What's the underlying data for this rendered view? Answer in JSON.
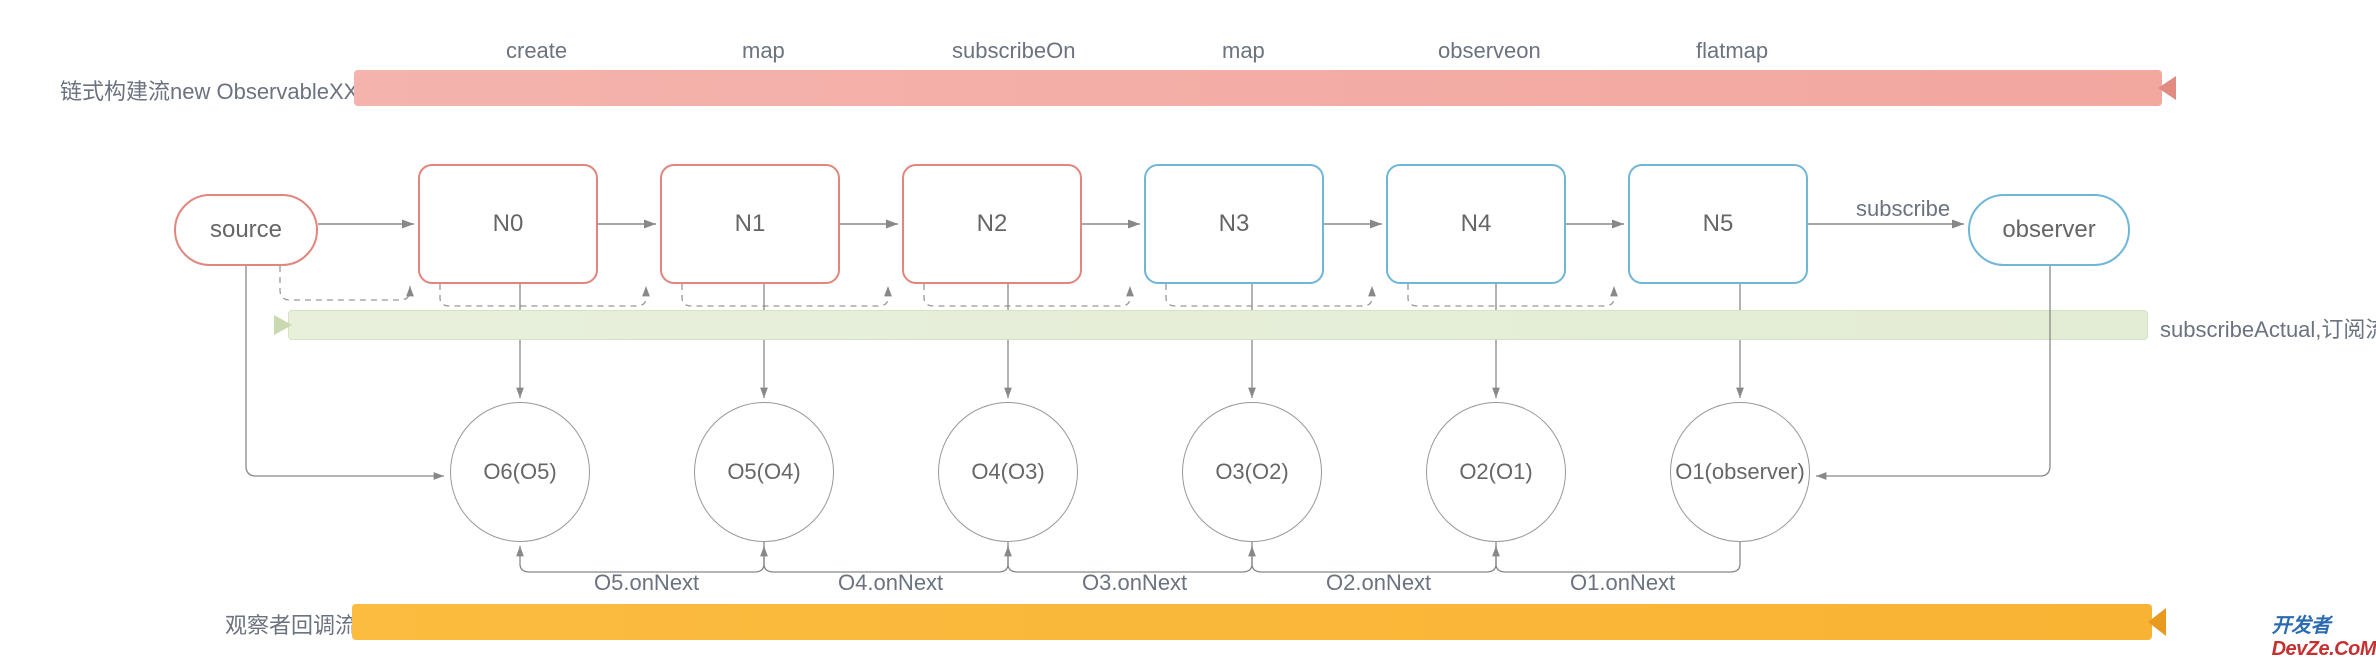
{
  "topBar": {
    "leftLabel": "链式构建流new ObservableXXX",
    "operators": [
      "create",
      "map",
      "subscribeOn",
      "map",
      "observeon",
      "flatmap"
    ]
  },
  "nodes": {
    "source": "source",
    "n": [
      "N0",
      "N1",
      "N2",
      "N3",
      "N4",
      "N5"
    ],
    "subscribeLabel": "subscribe",
    "observer": "observer"
  },
  "midBar": {
    "rightLabel": "subscribeActual,订阅流"
  },
  "observers": {
    "o": [
      "O6(O5)",
      "O5(O4)",
      "O4(O3)",
      "O3(O2)",
      "O2(O1)",
      "O1(observer)"
    ],
    "onNext": [
      "O5.onNext",
      "O4.onNext",
      "O3.onNext",
      "O2.onNext",
      "O1.onNext"
    ]
  },
  "bottomBar": {
    "leftLabel": "观察者回调流"
  },
  "colors": {
    "redBorder": "#e0867d",
    "blueBorder": "#6fb6d9",
    "barRed": "#f2a79f",
    "barGreen": "#e3ecd4",
    "barOrange": "#f9b334",
    "arrow": "#888",
    "text": "#6b7280"
  },
  "watermark": {
    "cn": "开发者",
    "en": "DevZe.CoM"
  }
}
